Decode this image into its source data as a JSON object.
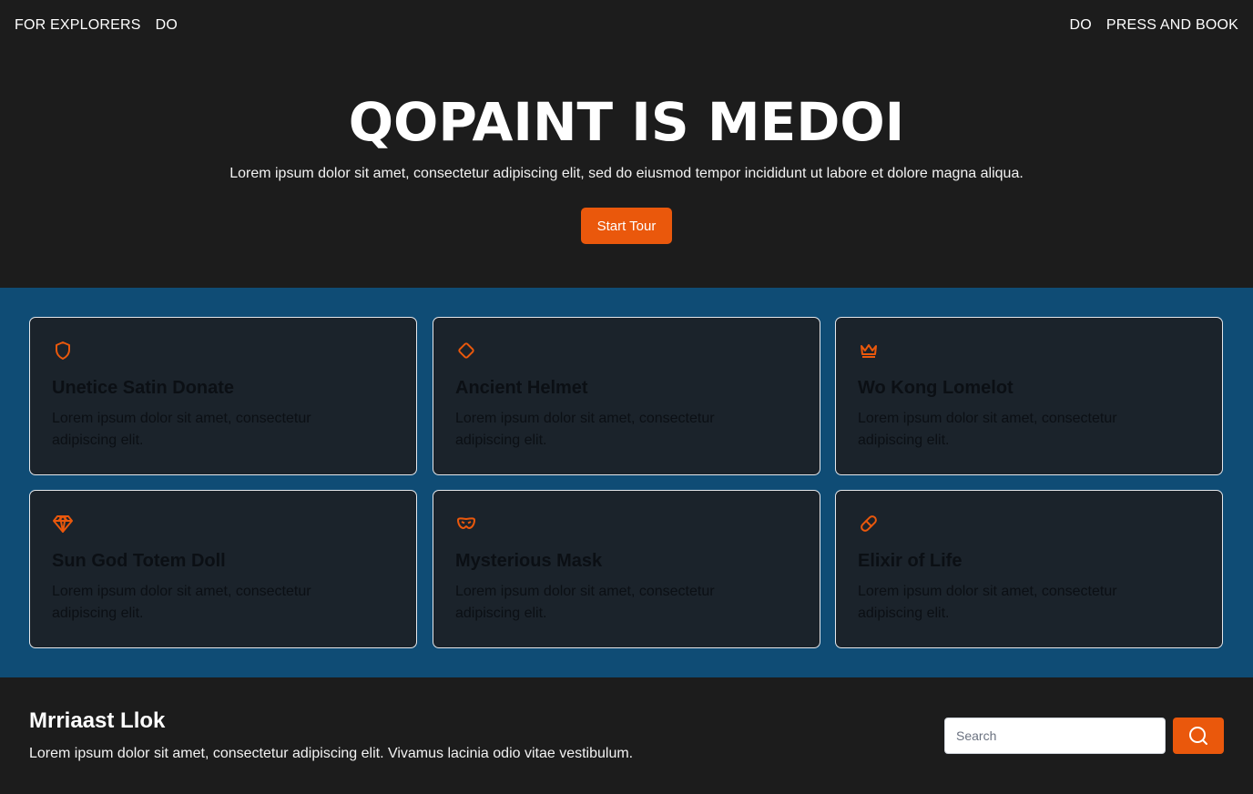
{
  "nav": {
    "left": [
      "FOR EXPLORERS",
      "DO"
    ],
    "right": [
      "DO",
      "PRESS AND BOOK"
    ]
  },
  "hero": {
    "title": "QOPAINT IS MEDOI",
    "subtitle": "Lorem ipsum dolor sit amet, consectetur adipiscing elit, sed do eiusmod tempor incididunt ut labore et dolore magna aliqua.",
    "cta_label": "Start Tour"
  },
  "colors": {
    "accent": "#ea580c",
    "features_bg": "#0f4c75",
    "page_bg": "#1c1c1c",
    "card_bg": "#1b232b"
  },
  "features": [
    {
      "icon": "shield-icon",
      "title": "Unetice Satin Donate",
      "desc": "Lorem ipsum dolor sit amet, consectetur adipiscing elit."
    },
    {
      "icon": "diamond-icon",
      "title": "Ancient Helmet",
      "desc": "Lorem ipsum dolor sit amet, consectetur adipiscing elit."
    },
    {
      "icon": "crown-icon",
      "title": "Wo Kong Lomelot",
      "desc": "Lorem ipsum dolor sit amet, consectetur adipiscing elit."
    },
    {
      "icon": "gem-icon",
      "title": "Sun God Totem Doll",
      "desc": "Lorem ipsum dolor sit amet, consectetur adipiscing elit."
    },
    {
      "icon": "mask-icon",
      "title": "Mysterious Mask",
      "desc": "Lorem ipsum dolor sit amet, consectetur adipiscing elit."
    },
    {
      "icon": "pill-icon",
      "title": "Elixir of Life",
      "desc": "Lorem ipsum dolor sit amet, consectetur adipiscing elit."
    }
  ],
  "footer": {
    "title": "Mrriaast Llok",
    "text": "Lorem ipsum dolor sit amet, consectetur adipiscing elit. Vivamus lacinia odio vitae vestibulum.",
    "search_placeholder": "Search",
    "search_icon": "search-icon"
  }
}
